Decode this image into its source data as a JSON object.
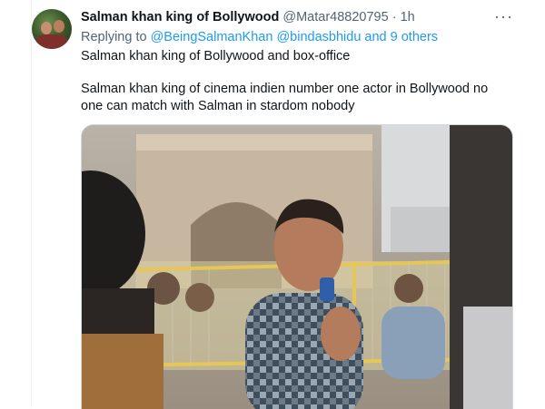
{
  "tweet": {
    "display_name": "Salman khan king of Bollywood",
    "handle": "@Matar48820795",
    "separator": "·",
    "time": "1h",
    "more_icon": "more-horizontal-icon",
    "reply": {
      "prefix": "Replying to",
      "mentions": [
        "@BeingSalmanKhan",
        "@bindasbhidu"
      ],
      "and_others": "and 9 others"
    },
    "text_lines": [
      "Salman khan king of Bollywood and box-office",
      "Salman khan king of cinema indien number one actor in Bollywood no one can match with Salman in stardom nobody"
    ]
  },
  "colors": {
    "link": "#1d9bf0",
    "secondary_text": "#536471",
    "primary_text": "#0f1419"
  }
}
